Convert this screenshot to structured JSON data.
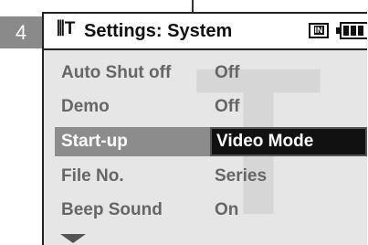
{
  "step": {
    "number": "4"
  },
  "header": {
    "icon": "settings-tool-icon",
    "icon_glyph": "⫼T",
    "title": "Settings: System",
    "card_icon": "memory-card-icon",
    "card_label": "IN",
    "battery_icon": "battery-icon"
  },
  "menu": {
    "items": [
      {
        "label": "Auto Shut off",
        "value": "Off"
      },
      {
        "label": "Demo",
        "value": "Off"
      },
      {
        "label": "Start-up",
        "value": "Video Mode",
        "selected": true
      },
      {
        "label": "File No.",
        "value": "Series"
      },
      {
        "label": "Beep Sound",
        "value": "On"
      }
    ],
    "more_indicator": "chevron-down-icon"
  },
  "colors": {
    "screen_bg": "#e6e6e6",
    "selected_label_bg": "#8c8c8c",
    "selected_value_bg": "#111111",
    "text_dim": "#666666"
  }
}
